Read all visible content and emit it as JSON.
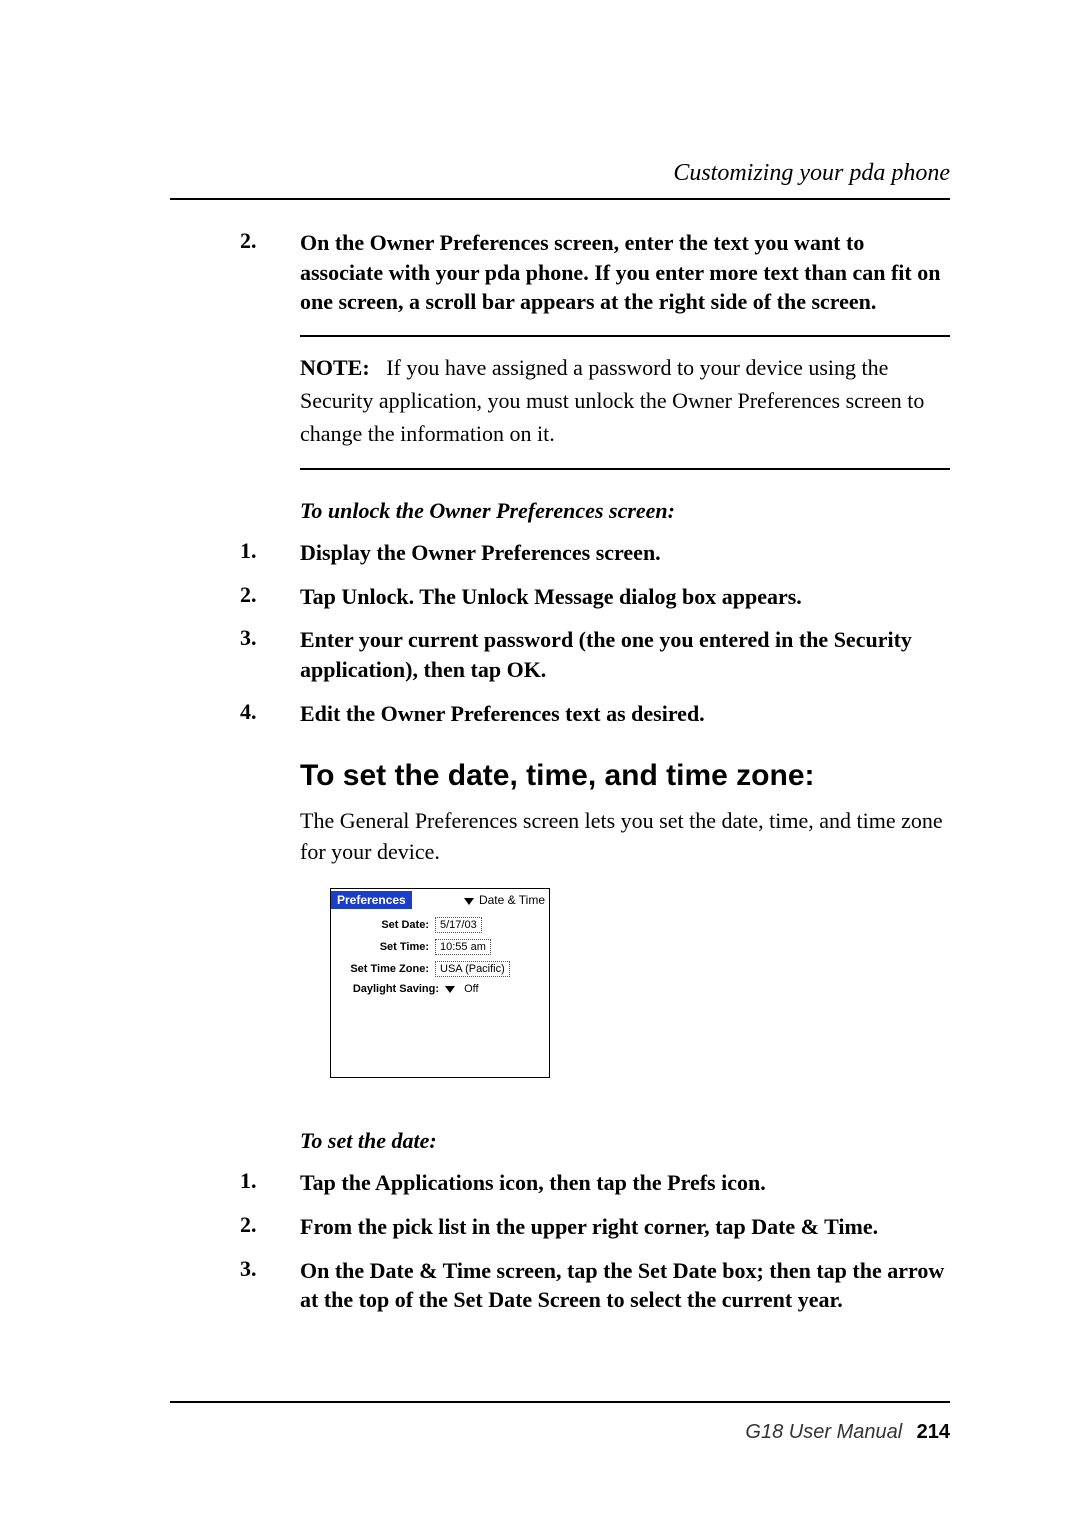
{
  "header": {
    "section_title": "Customizing your pda phone"
  },
  "step2_top": {
    "num": "2.",
    "text": "On the Owner Preferences screen, enter the text you want to associate with your pda phone. If you enter more text than can fit on one screen, a scroll bar appears at the right side of the screen."
  },
  "note": {
    "label": "NOTE:",
    "text": "If you have assigned a password to your device using the Security application, you must unlock the Owner Preferences screen to change the information on it."
  },
  "unlock": {
    "heading": "To unlock the Owner Preferences screen:",
    "items": [
      {
        "num": "1.",
        "text": "Display the Owner Preferences screen."
      },
      {
        "num": "2.",
        "text": "Tap Unlock. The Unlock Message dialog box appears."
      },
      {
        "num": "3.",
        "text": "Enter your current password (the one you entered in the Security application), then tap OK."
      },
      {
        "num": "4.",
        "text": "Edit the Owner Preferences text as desired."
      }
    ]
  },
  "datetime": {
    "title": "To set the date, time, and time zone:",
    "intro": "The General Preferences screen lets you set the date, time, and time zone for your device."
  },
  "screenshot": {
    "app_title": "Preferences",
    "dropdown": "Date & Time",
    "rows": {
      "date_label": "Set Date:",
      "date_value": "5/17/03",
      "time_label": "Set Time:",
      "time_value": "10:55 am",
      "tz_label": "Set Time Zone:",
      "tz_value": "USA (Pacific)",
      "dst_label": "Daylight Saving:",
      "dst_value": "Off"
    }
  },
  "setdate": {
    "heading": "To set the date:",
    "items": [
      {
        "num": "1.",
        "text": "Tap the Applications icon, then tap the Prefs icon."
      },
      {
        "num": "2.",
        "text": "From the pick list in the upper right corner, tap Date & Time."
      },
      {
        "num": "3.",
        "text": "On the Date & Time screen, tap the Set Date box; then tap the arrow at the top of the Set Date Screen to select the current year."
      }
    ]
  },
  "footer": {
    "manual": "G18 User Manual",
    "page": "214"
  }
}
